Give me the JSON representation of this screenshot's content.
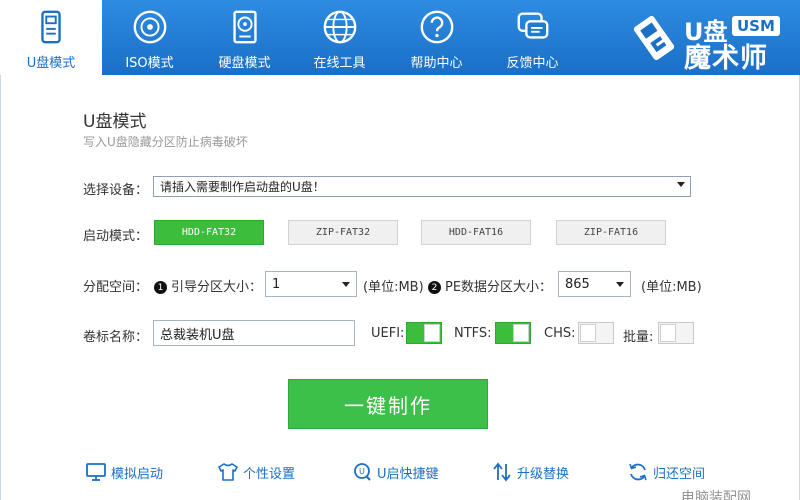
{
  "tabs": [
    {
      "label": "U盘模式",
      "icon": "usb-drive-icon",
      "active": true
    },
    {
      "label": "ISO模式",
      "icon": "disc-icon",
      "active": false
    },
    {
      "label": "硬盘模式",
      "icon": "hard-disk-icon",
      "active": false
    },
    {
      "label": "在线工具",
      "icon": "globe-icon",
      "active": false
    },
    {
      "label": "帮助中心",
      "icon": "question-icon",
      "active": false
    },
    {
      "label": "反馈中心",
      "icon": "chat-bubble-icon",
      "active": false
    }
  ],
  "logo": {
    "u": "U盘",
    "usm": "USM",
    "cn": "魔术师"
  },
  "mode": {
    "title": "U盘模式",
    "subtitle": "写入U盘隐藏分区防止病毒破坏"
  },
  "device": {
    "label": "选择设备：",
    "value": "请插入需要制作启动盘的U盘！"
  },
  "boot": {
    "label": "启动模式：",
    "options": [
      "HDD-FAT32",
      "ZIP-FAT32",
      "HDD-FAT16",
      "ZIP-FAT16"
    ],
    "selected": "HDD-FAT32"
  },
  "partition": {
    "label": "分配空间：",
    "boot_num": "1",
    "boot_label": "引导分区大小：",
    "boot_value": "1",
    "boot_unit": "(单位:MB)",
    "pe_num": "2",
    "pe_label": "PE数据分区大小：",
    "pe_value": "865",
    "pe_unit": "(单位:MB)"
  },
  "volume": {
    "label": "卷标名称：",
    "value": "总裁装机U盘"
  },
  "toggles": [
    {
      "label": "UEFI:",
      "on": true
    },
    {
      "label": "NTFS:",
      "on": true
    },
    {
      "label": "CHS:",
      "on": false
    },
    {
      "label": "批量:",
      "on": false
    }
  ],
  "make_button": "一键制作",
  "bottom_links": [
    {
      "label": "模拟启动",
      "icon": "monitor-icon"
    },
    {
      "label": "个性设置",
      "icon": "tshirt-icon"
    },
    {
      "label": "U启快捷键",
      "icon": "search-key-icon"
    },
    {
      "label": "升级替换",
      "icon": "upgrade-arrows-icon"
    },
    {
      "label": "归还空间",
      "icon": "refresh-icon"
    }
  ],
  "watermark": "电脑装配网",
  "colors": {
    "toolbar": "#1a6fc6",
    "accent_green": "#3cbe3c",
    "link": "#1a6fc6"
  }
}
